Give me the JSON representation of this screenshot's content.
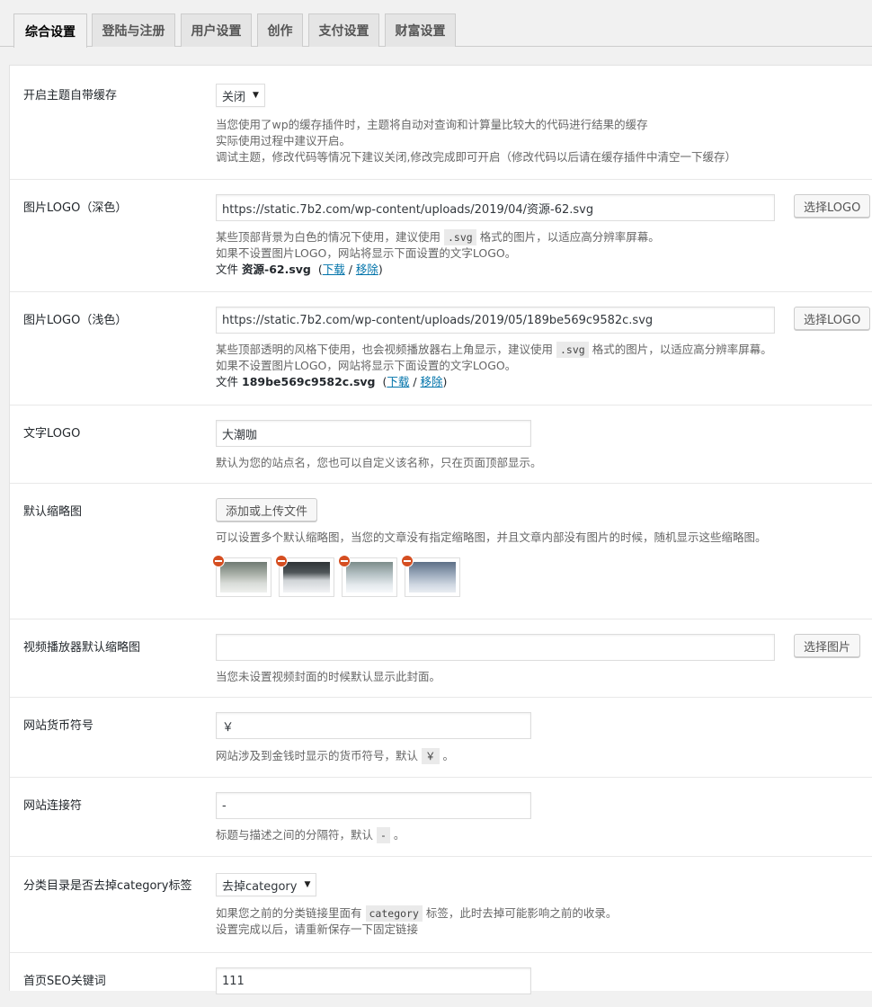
{
  "tabs": [
    "综合设置",
    "登陆与注册",
    "用户设置",
    "创作",
    "支付设置",
    "财富设置"
  ],
  "cache": {
    "label": "开启主题自带缓存",
    "value": "关闭",
    "desc": [
      "当您使用了wp的缓存插件时，主题将自动对查询和计算量比较大的代码进行结果的缓存",
      "实际使用过程中建议开启。",
      "调试主题，修改代码等情况下建议关闭,修改完成即可开启（修改代码以后请在缓存插件中清空一下缓存）"
    ]
  },
  "logo_dark": {
    "label": "图片LOGO（深色）",
    "value": "https://static.7b2.com/wp-content/uploads/2019/04/资源-62.svg",
    "button": "选择LOGO",
    "desc1_pre": "某些顶部背景为白色的情况下使用，建议使用",
    "desc1_code": ".svg",
    "desc1_post": "格式的图片，以适应高分辨率屏幕。",
    "desc2": "如果不设置图片LOGO，网站将显示下面设置的文字LOGO。",
    "file_prefix": "文件",
    "file_name": "资源-62.svg",
    "download": "下载",
    "remove": "移除"
  },
  "logo_light": {
    "label": "图片LOGO（浅色）",
    "value": "https://static.7b2.com/wp-content/uploads/2019/05/189be569c9582c.svg",
    "button": "选择LOGO",
    "desc1_pre": "某些顶部透明的风格下使用，也会视频播放器右上角显示，建议使用",
    "desc1_code": ".svg",
    "desc1_post": "格式的图片，以适应高分辨率屏幕。",
    "desc2": "如果不设置图片LOGO，网站将显示下面设置的文字LOGO。",
    "file_prefix": "文件",
    "file_name": "189be569c9582c.svg",
    "download": "下载",
    "remove": "移除"
  },
  "text_logo": {
    "label": "文字LOGO",
    "value": "大潮咖",
    "desc": "默认为您的站点名，您也可以自定义该名称，只在页面顶部显示。"
  },
  "default_thumb": {
    "label": "默认缩略图",
    "button": "添加或上传文件",
    "desc": "可以设置多个默认缩略图，当您的文章没有指定缩略图，并且文章内部没有图片的时候，随机显示这些缩略图。"
  },
  "video_thumb": {
    "label": "视频播放器默认缩略图",
    "value": "",
    "button": "选择图片",
    "desc": "当您未设置视频封面的时候默认显示此封面。"
  },
  "currency": {
    "label": "网站货币符号",
    "value": "￥",
    "desc_pre": "网站涉及到金钱时显示的货币符号，默认",
    "desc_code": "￥",
    "desc_post": "。"
  },
  "separator": {
    "label": "网站连接符",
    "value": "-",
    "desc_pre": "标题与描述之间的分隔符，默认",
    "desc_code": "-",
    "desc_post": "。"
  },
  "category": {
    "label": "分类目录是否去掉category标签",
    "value": "去掉category",
    "desc1_pre": "如果您之前的分类链接里面有",
    "desc1_code": "category",
    "desc1_post": "标签，此时去掉可能影响之前的收录。",
    "desc2": "设置完成以后，请重新保存一下固定链接"
  },
  "seo_keywords": {
    "label": "首页SEO关键词",
    "value": "111"
  }
}
